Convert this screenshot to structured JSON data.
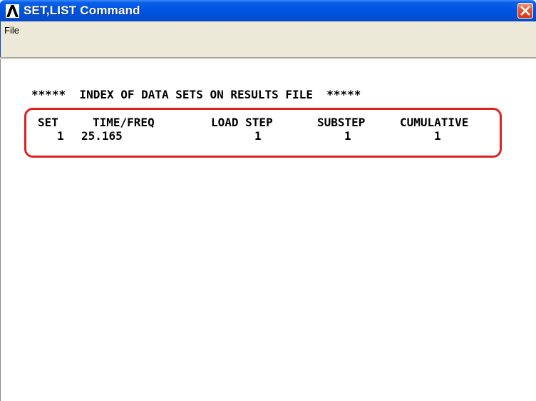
{
  "window": {
    "title": "SET,LIST Command",
    "icon": "ansys-logo-icon",
    "close_icon": "close-icon"
  },
  "menubar": {
    "items": [
      {
        "label": "File"
      }
    ]
  },
  "output": {
    "heading": "*****  INDEX OF DATA SETS ON RESULTS FILE  *****",
    "columns": [
      "SET",
      "TIME/FREQ",
      "LOAD STEP",
      "SUBSTEP",
      "CUMULATIVE"
    ],
    "rows": [
      {
        "set": "1",
        "time_freq": "25.165",
        "load_step": "1",
        "substep": "1",
        "cumulative": "1"
      }
    ]
  },
  "annotation": {
    "highlight_color": "#e02020"
  },
  "colors": {
    "titlebar": "#0054e3",
    "menubar": "#ece9d8",
    "close": "#d43a17"
  }
}
